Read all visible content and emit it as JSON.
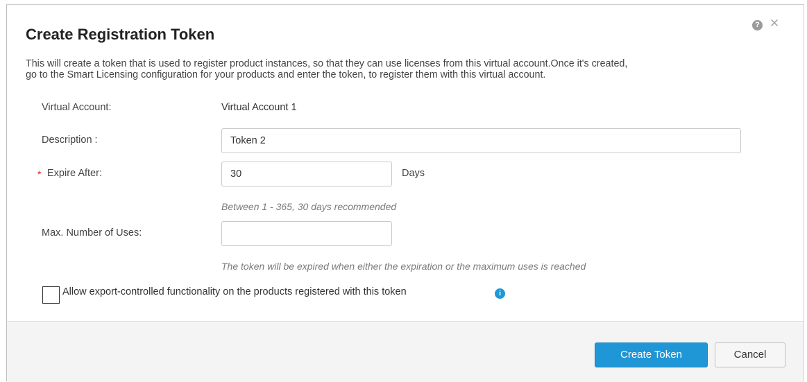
{
  "dialog": {
    "title": "Create Registration Token",
    "help_icon": "help-icon",
    "close_icon": "close-icon",
    "intro_line1": "This will create a token that is used to register product instances, so that they can use licenses from this virtual account.Once it's created,",
    "intro_line2": "go to the Smart Licensing configuration for your products and enter the token, to register them with this virtual account."
  },
  "form": {
    "virtual_account": {
      "label": "Virtual Account:",
      "value": "Virtual Account 1"
    },
    "description": {
      "label": "Description :",
      "value": "Token 2",
      "placeholder": ""
    },
    "expire_after": {
      "required_mark": "*",
      "label": "Expire After:",
      "value": "30",
      "unit": "Days",
      "hint": "Between 1 - 365, 30 days recommended"
    },
    "max_uses": {
      "label": "Max. Number of Uses:",
      "value": "",
      "hint": "The token will be expired when either the expiration or the maximum uses is reached"
    },
    "export_controlled": {
      "label": "Allow export-controlled functionality on the products registered with this token",
      "checked": false,
      "info_icon": "info-icon"
    }
  },
  "footer": {
    "primary_label": "Create Token",
    "cancel_label": "Cancel"
  },
  "colors": {
    "primary_button": "#1f96d6",
    "required_star": "#d9261c",
    "info_icon": "#1d98d8"
  }
}
